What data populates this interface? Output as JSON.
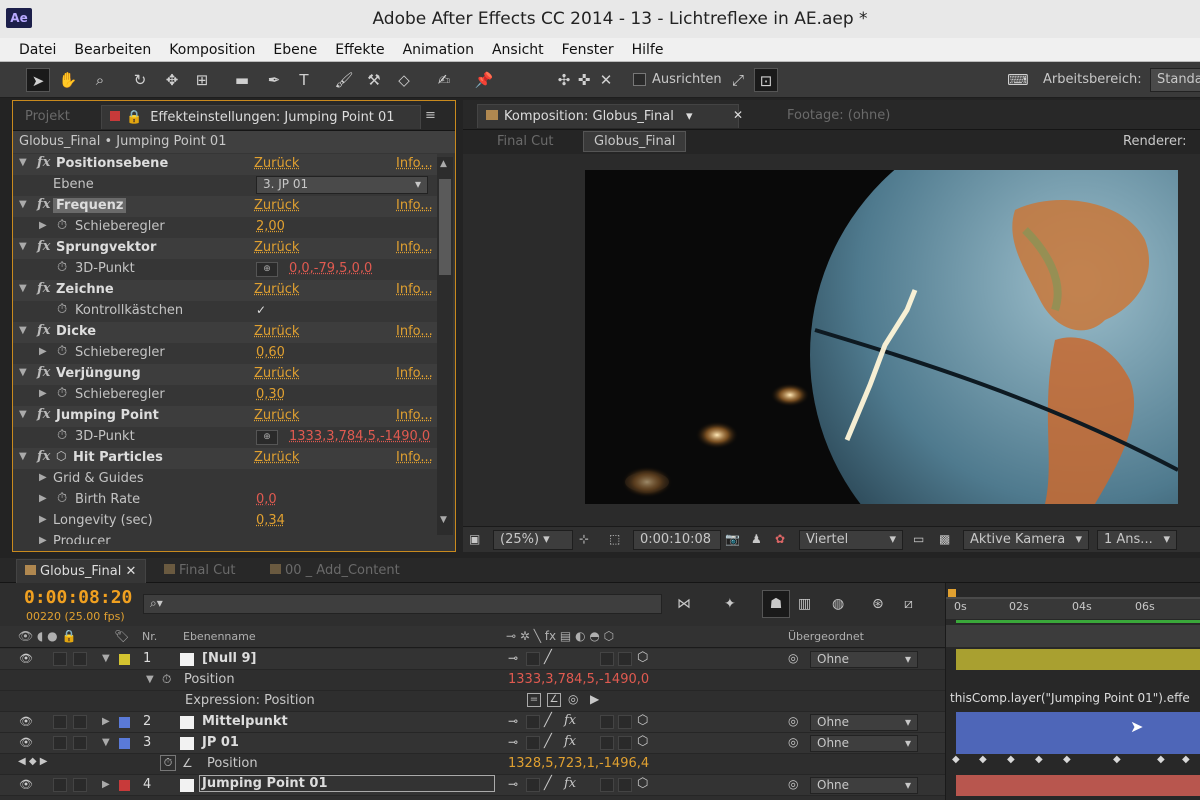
{
  "app": {
    "logo": "Ae",
    "title": "Adobe After Effects CC 2014 - 13 - Lichtreflexe in AE.aep *"
  },
  "menu": [
    "Datei",
    "Bearbeiten",
    "Komposition",
    "Ebene",
    "Effekte",
    "Animation",
    "Ansicht",
    "Fenster",
    "Hilfe"
  ],
  "toolbar": {
    "align_label": "Ausrichten",
    "workspace_label": "Arbeitsbereich:",
    "workspace_value": "Standa"
  },
  "left_panel": {
    "tab_project": "Projekt",
    "tab_effects": "Effekteinstellungen: Jumping Point 01",
    "header": "Globus_Final • Jumping Point 01",
    "rows": [
      {
        "type": "effect",
        "name": "Positionsebene",
        "reset": "Zurück",
        "info": "Info..."
      },
      {
        "type": "param",
        "name": "Ebene",
        "dropdown": "3. JP 01"
      },
      {
        "type": "effect",
        "name": "Frequenz",
        "reset": "Zurück",
        "info": "Info...",
        "highlight": true
      },
      {
        "type": "param",
        "name": "Schieberegler",
        "value": "2,00"
      },
      {
        "type": "effect",
        "name": "Sprungvektor",
        "reset": "Zurück",
        "info": "Info..."
      },
      {
        "type": "param",
        "name": "3D-Punkt",
        "point": "0,0,-79,5,0,0"
      },
      {
        "type": "effect",
        "name": "Zeichne",
        "reset": "Zurück",
        "info": "Info..."
      },
      {
        "type": "param",
        "name": "Kontrollkästchen",
        "check": "✓"
      },
      {
        "type": "effect",
        "name": "Dicke",
        "reset": "Zurück",
        "info": "Info..."
      },
      {
        "type": "param",
        "name": "Schieberegler",
        "value": "0,60"
      },
      {
        "type": "effect",
        "name": "Verjüngung",
        "reset": "Zurück",
        "info": "Info..."
      },
      {
        "type": "param",
        "name": "Schieberegler",
        "value": "0,30"
      },
      {
        "type": "effect",
        "name": "Jumping Point",
        "reset": "Zurück",
        "info": "Info..."
      },
      {
        "type": "param",
        "name": "3D-Punkt",
        "point": "1333,3,784,5,-1490,0",
        "red": true
      },
      {
        "type": "effect",
        "name": "Hit Particles",
        "reset": "Zurück",
        "info": "Info..."
      },
      {
        "type": "group",
        "name": "Grid & Guides"
      },
      {
        "type": "param",
        "name": "Birth Rate",
        "value": "0,0",
        "red": true
      },
      {
        "type": "group",
        "name": "Longevity (sec)",
        "value": "0,34"
      },
      {
        "type": "group",
        "name": "Producer"
      }
    ]
  },
  "comp_panel": {
    "tab_comp": "Komposition: Globus_Final",
    "tab_footage": "Footage: (ohne)",
    "crumb_1": "Final Cut",
    "crumb_2": "Globus_Final",
    "renderer": "Renderer:",
    "zoom": "(25%)",
    "timecode": "0:00:10:08",
    "resolution": "Viertel",
    "camera": "Aktive Kamera",
    "views": "1 Ans..."
  },
  "timeline": {
    "tabs": [
      "Globus_Final",
      "Final Cut",
      "00 _ Add_Content"
    ],
    "time": "0:00:08:20",
    "fps": "00220 (25.00 fps)",
    "search_placeholder": "⌕▾",
    "col_nr": "Nr.",
    "col_name": "Ebenenname",
    "col_parent": "Übergeordnet",
    "ruler": [
      "0s",
      "02s",
      "04s",
      "06s"
    ],
    "layers": [
      {
        "num": "1",
        "name": "[Null 9]",
        "color": "#d4c430",
        "parent": "Ohne",
        "expanded": true
      },
      {
        "prop": "Position",
        "value": "1333,3,784,5,-1490,0"
      },
      {
        "expr_label": "Expression: Position",
        "expr_text": "thisComp.layer(\"Jumping Point 01\").effe"
      },
      {
        "num": "2",
        "name": "Mittelpunkt",
        "color": "#5a7ad8",
        "parent": "Ohne"
      },
      {
        "num": "3",
        "name": "JP 01",
        "color": "#5a7ad8",
        "parent": "Ohne",
        "expanded": true
      },
      {
        "prop": "Position",
        "value": "1328,5,723,1,-1496,4"
      },
      {
        "num": "4",
        "name": "Jumping Point 01",
        "color": "#c83a3a",
        "parent": "Ohne",
        "selected": true
      }
    ]
  },
  "colors": {
    "accent": "#e0a030",
    "red_value": "#e05a50",
    "layer_yellow": "#a9a030",
    "layer_blue": "#4e66b8",
    "layer_red": "#b8564e"
  }
}
